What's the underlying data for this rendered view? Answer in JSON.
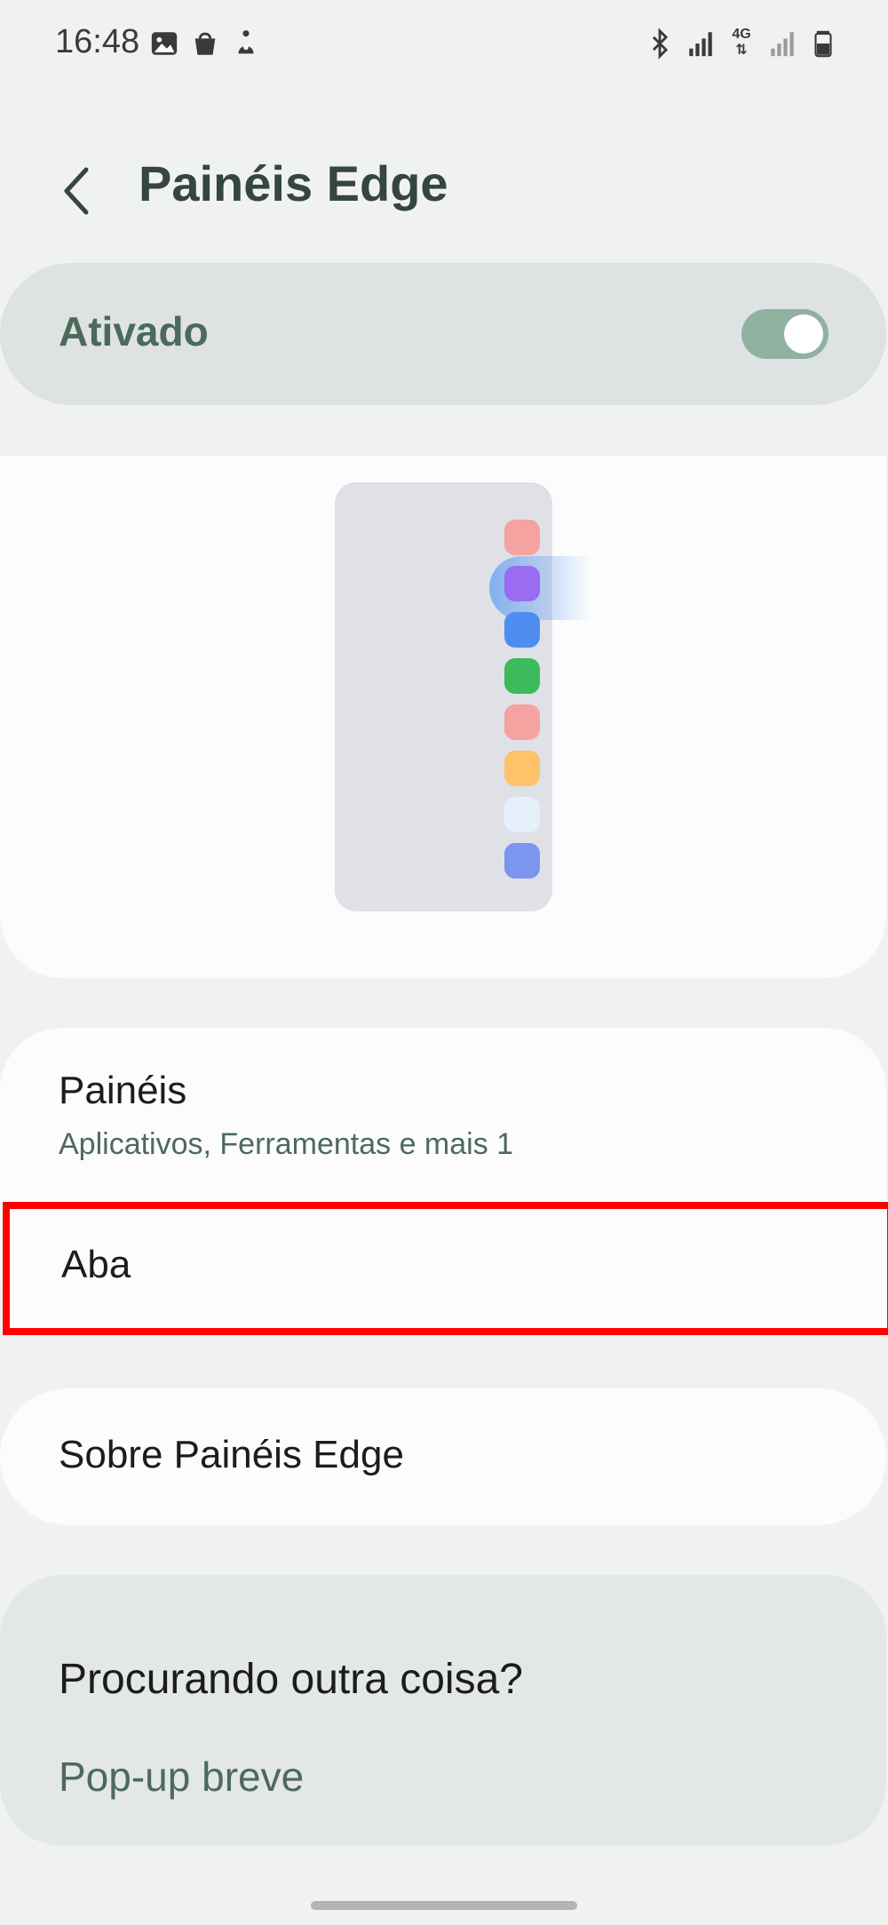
{
  "status_bar": {
    "time": "16:48",
    "left_icons": [
      "gallery-icon",
      "shopping-bag-icon",
      "accessibility-icon"
    ],
    "right_icons": [
      "bluetooth-icon",
      "signal-icon",
      "4g-icon",
      "signal-icon",
      "battery-icon"
    ],
    "network_label": "4G"
  },
  "header": {
    "back_icon": "chevron-left-icon",
    "title": "Painéis Edge"
  },
  "master_toggle": {
    "label": "Ativado",
    "on": true
  },
  "preview": {
    "app_colors": [
      "#f4a3a0",
      "#9b6cf2",
      "#4f8ef0",
      "#3dba5a",
      "#f4a3a0",
      "#ffc26b",
      "#e6f0fa",
      "#7c95ef"
    ]
  },
  "settings": {
    "panels_title": "Painéis",
    "panels_subtitle": "Aplicativos, Ferramentas e mais 1",
    "tab_title": "Aba",
    "about_title": "Sobre Painéis Edge"
  },
  "search_suggestions": {
    "title": "Procurando outra coisa?",
    "link": "Pop-up breve"
  },
  "colors": {
    "accent": "#8fb2a0",
    "highlight": "#ff0000"
  }
}
